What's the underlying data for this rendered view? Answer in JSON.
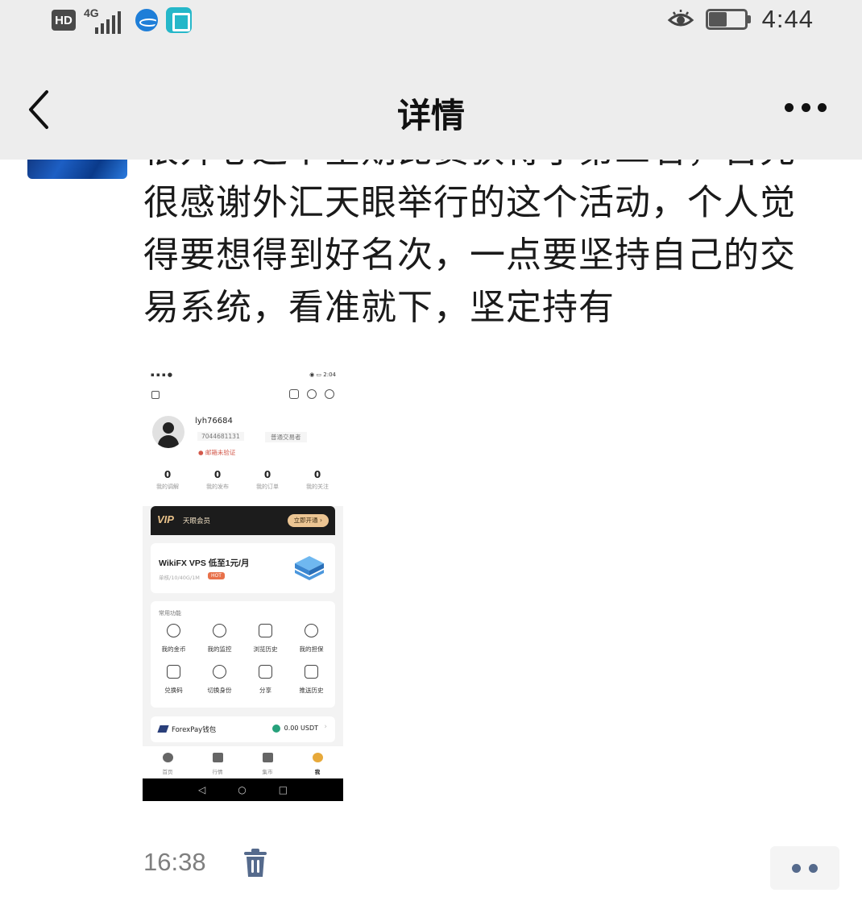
{
  "status_bar": {
    "hd_badge": "HD",
    "network": "4G",
    "time": "4:44",
    "battery_level": 0.5,
    "icons": [
      "hd-icon",
      "signal-icon",
      "globe-app-icon",
      "book-app-icon",
      "eye-icon",
      "battery-icon"
    ]
  },
  "nav": {
    "title": "详情",
    "back_icon": "chevron-left-icon",
    "more_icon": "more-icon"
  },
  "post": {
    "text": "很开心这个星期比赛获得了第二名，首先很感谢外汇天眼举行的这个活动，个人觉得要想得到好名次，一点要坚持自己的交易系统，看准就下，坚定持有",
    "time": "16:38"
  },
  "screenshot": {
    "status_time": "2:04",
    "username": "lyh76684",
    "user_id": "7044681131",
    "role": "普通交易者",
    "email_status": "● 邮箱未验证",
    "stats": [
      {
        "value": "0",
        "label": "我的调解"
      },
      {
        "value": "0",
        "label": "我的发布"
      },
      {
        "value": "0",
        "label": "我的订单"
      },
      {
        "value": "0",
        "label": "我的关注"
      }
    ],
    "vip": {
      "badge": "VIP",
      "name": "天眼会员",
      "button": "立即开通 ›"
    },
    "vps": {
      "title": "WikiFX VPS 低至1元/月",
      "subtitle": "单核/10/40G/1M",
      "hot": "HOT"
    },
    "functions_title": "常用功能",
    "functions": [
      {
        "label": "我的金币",
        "icon": "coin-icon"
      },
      {
        "label": "我的监控",
        "icon": "camera-icon"
      },
      {
        "label": "浏览历史",
        "icon": "history-icon"
      },
      {
        "label": "我的担保",
        "icon": "shield-icon"
      },
      {
        "label": "兑换码",
        "icon": "barcode-icon"
      },
      {
        "label": "切换身份",
        "icon": "switch-user-icon"
      },
      {
        "label": "分享",
        "icon": "share-icon"
      },
      {
        "label": "推送历史",
        "icon": "push-history-icon"
      }
    ],
    "wallet": {
      "name": "ForexPay钱包",
      "balance": "0.00 USDT"
    },
    "tabs": [
      {
        "label": "首页",
        "icon": "home-icon",
        "active": false
      },
      {
        "label": "行情",
        "icon": "market-icon",
        "active": false
      },
      {
        "label": "集市",
        "icon": "store-icon",
        "active": false
      },
      {
        "label": "我",
        "icon": "profile-icon",
        "active": true
      }
    ],
    "system_nav": [
      "◁",
      "○",
      "□"
    ]
  },
  "footer": {
    "delete_icon": "trash-icon",
    "action_icon": "more-dots-icon"
  },
  "colors": {
    "nav_bg": "#ededed",
    "accent_blue": "#556a8c",
    "vip_gold": "#ecc593",
    "hot_orange": "#e8714a"
  }
}
